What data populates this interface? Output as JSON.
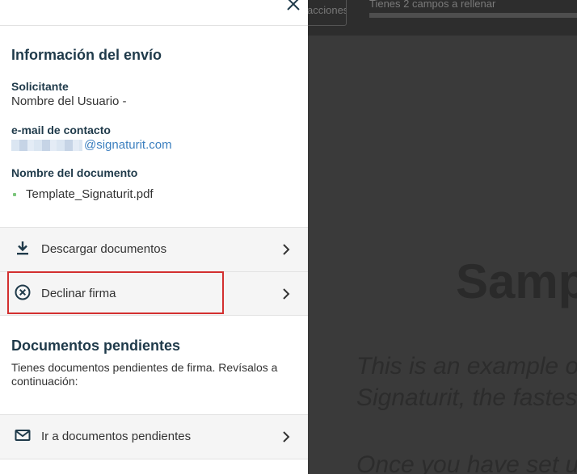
{
  "background": {
    "toolbar_button": "acciones",
    "toolbar_text": "Tienes 2 campos a rellenar",
    "doc_title": "Samp",
    "doc_lines": [
      "This is an example o",
      "Signaturit, the fastes",
      "Once you have set u"
    ]
  },
  "panel": {
    "info_title": "Información del envío",
    "solicitante_label": "Solicitante",
    "solicitante_value": "Nombre del Usuario -",
    "email_label": "e-mail de contacto",
    "email_domain": "@signaturit.com",
    "document_label": "Nombre del documento",
    "document_name": "Template_Signaturit.pdf",
    "actions": [
      {
        "label": "Descargar documentos",
        "icon": "download-icon"
      },
      {
        "label": "Declinar firma",
        "icon": "cancel-circle-icon"
      }
    ],
    "pending_title": "Documentos pendientes",
    "pending_text": "Tienes documentos pendientes de firma. Revísalos a continuación:",
    "pending_action": {
      "label": "Ir a documentos pendientes",
      "icon": "mail-icon"
    }
  },
  "colors": {
    "heading": "#1f3a4a",
    "link": "#3b7fbf",
    "highlight": "#d32f2f",
    "action_bg": "#f5f5f5"
  }
}
